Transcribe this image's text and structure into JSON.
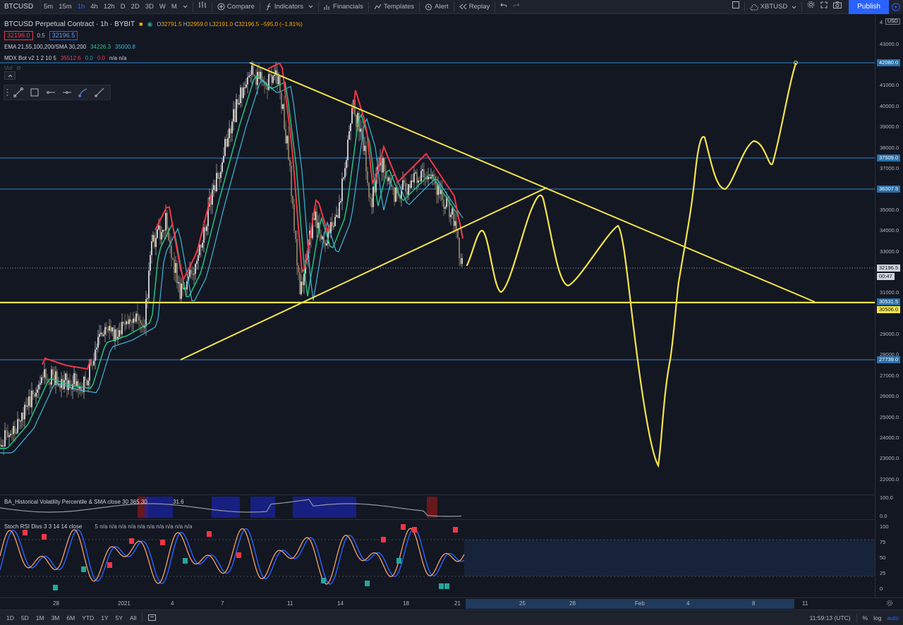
{
  "toolbar": {
    "symbol": "BTCUSD",
    "intervals": [
      "5m",
      "15m",
      "1h",
      "4h",
      "12h",
      "D",
      "2D",
      "3D",
      "W",
      "M"
    ],
    "active_interval": "1h",
    "compare_label": "Compare",
    "indicators_label": "Indicators",
    "financials_label": "Financials",
    "templates_label": "Templates",
    "alert_label": "Alert",
    "replay_label": "Replay",
    "symbol_right": "XBTUSD",
    "publish_label": "Publish"
  },
  "legend": {
    "title": "BTCUSD Perpetual Contract · 1h · BYBIT",
    "ohlc": {
      "o": "32791.5",
      "h": "32959.0",
      "l": "32191.0",
      "c": "32196.5",
      "change": "−595.0 (−1.81%)"
    },
    "bid": "32196.0",
    "spread": "0.5",
    "ask": "32196.5",
    "ema_name": "EMA 21,55,100,200/SMA 30,200",
    "ema_v1": "34226.3",
    "ema_v2": "35000.8",
    "mdx_name": "MDX Bot v2 1 2 10 5",
    "mdx_v1": "35512.6",
    "mdx_v2": "0.0",
    "mdx_v3": "0.0",
    "mdx_v4": "n/a n/a",
    "vol_label": "Vol"
  },
  "colors": {
    "background": "#131722",
    "accent": "#2962ff",
    "yellow": "#f5e44a",
    "hline": "#2a6fa8",
    "red": "#f23645",
    "green": "#26a69a"
  },
  "price_axis": {
    "currency": "USD",
    "labels": [
      "43000.0",
      "41000.0",
      "40000.0",
      "39000.0",
      "38000.0",
      "37000.0",
      "35000.0",
      "34000.0",
      "33000.0",
      "31000.0",
      "29000.0",
      "28000.0",
      "27000.0",
      "26000.0",
      "25000.0",
      "24000.0",
      "23000.0",
      "22000.0"
    ],
    "tags": {
      "t42080": "42080.0",
      "t37509": "37509.0",
      "t36007": "36007.5",
      "t_last": "32196.5",
      "t_countdown": "00:47",
      "t30531": "30531.5",
      "t30506": "30506.0",
      "t27739": "27739.0"
    }
  },
  "hvp_pane": {
    "title": "BA_Historical Volatility Percentile & SMA close 30 365 30",
    "value": "31.6",
    "axis": [
      "100.0",
      "0.0"
    ]
  },
  "stoch_pane": {
    "title": "Stoch RSI Divs 3 3 14 14 close",
    "values": "5 n/a n/a n/a n/a n/a n/a n/a n/a n/a n/a",
    "axis": [
      "100",
      "75",
      "50",
      "25",
      "0"
    ]
  },
  "time_axis": {
    "labels": [
      "28",
      "2021",
      "4",
      "7",
      "11",
      "14",
      "18",
      "21",
      "25",
      "28",
      "Feb",
      "4",
      "8",
      "11"
    ]
  },
  "bottom_bar": {
    "ranges": [
      "1D",
      "5D",
      "1M",
      "3M",
      "6M",
      "YTD",
      "1Y",
      "5Y",
      "All"
    ],
    "clock": "11:59:13 (UTC)",
    "pct": "%",
    "log": "log",
    "auto": "auto"
  }
}
